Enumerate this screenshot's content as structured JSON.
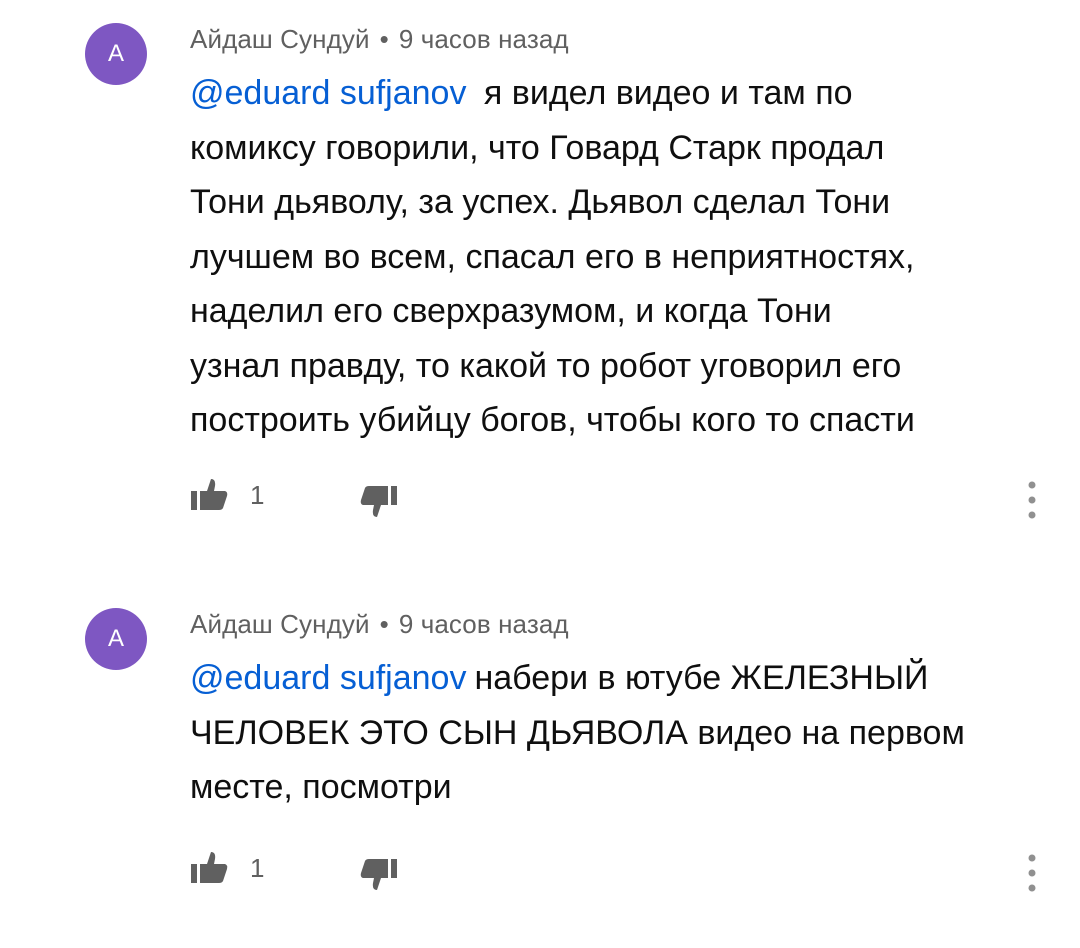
{
  "colors": {
    "avatar_bg": "#7e57c2",
    "mention": "#065fd4",
    "meta": "#606060",
    "text": "#0f0f0f"
  },
  "comments": [
    {
      "avatar_letter": "A",
      "author": "Айдаш Сундуй",
      "separator": "•",
      "time": "9 часов назад",
      "mention": "@eduard sufjanov",
      "lines": [
        "я видел видео и там по",
        "комиксу говорили, что Говард Старк продал",
        "Тони дьяволу, за успех. Дьявол сделал Тони",
        "лучшем во всем, спасал его в неприятностях,",
        "наделил его сверхразумом, и когда Тони",
        "узнал правду, то какой то робот уговорил его",
        "построить убийцу богов, чтобы кого то спасти"
      ],
      "likes": "1",
      "like_icon": "thumb-up-icon",
      "dislike_icon": "thumb-down-icon",
      "more_icon": "vertical-dots-icon"
    },
    {
      "avatar_letter": "A",
      "author": "Айдаш Сундуй",
      "separator": "•",
      "time": "9 часов назад",
      "mention": "@eduard sufjanov",
      "lines": [
        "набери в ютубе ЖЕЛЕЗНЫЙ",
        "ЧЕЛОВЕК ЭТО СЫН ДЬЯВОЛА видео  на первом",
        "месте, посмотри"
      ],
      "likes": "1",
      "like_icon": "thumb-up-icon",
      "dislike_icon": "thumb-down-icon",
      "more_icon": "vertical-dots-icon"
    }
  ]
}
